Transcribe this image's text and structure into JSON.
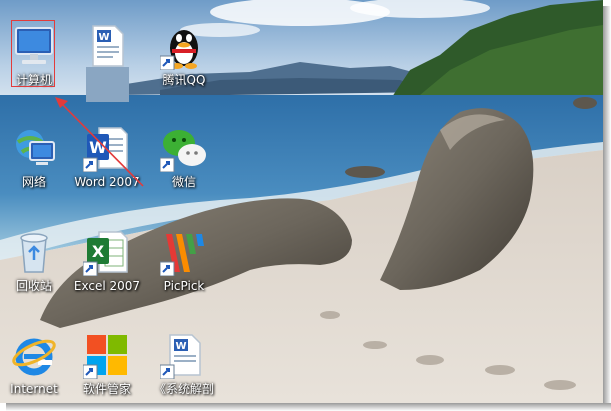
{
  "desktop": {
    "icons": [
      {
        "label": "计算机",
        "icon": "computer-icon"
      },
      {
        "label": "网络",
        "icon": "network-icon"
      },
      {
        "label": "回收站",
        "icon": "recycle-bin-icon"
      },
      {
        "label": "Internet",
        "icon": "internet-explorer-icon"
      },
      {
        "label": "",
        "icon": "word-document-icon"
      },
      {
        "label": "Word 2007",
        "icon": "word-icon"
      },
      {
        "label": "Excel 2007",
        "icon": "excel-icon"
      },
      {
        "label": "软件管家",
        "icon": "software-manager-icon"
      },
      {
        "label": "腾讯QQ",
        "icon": "qq-icon"
      },
      {
        "label": "微信",
        "icon": "wechat-icon"
      },
      {
        "label": "PicPick",
        "icon": "picpick-icon"
      },
      {
        "label": "《系统解剖",
        "icon": "word-document-icon"
      }
    ],
    "annotation": {
      "selection_color": "#e23b3b",
      "arrow_color": "#e23b3b"
    },
    "wallpaper": "beach-with-rocks"
  }
}
